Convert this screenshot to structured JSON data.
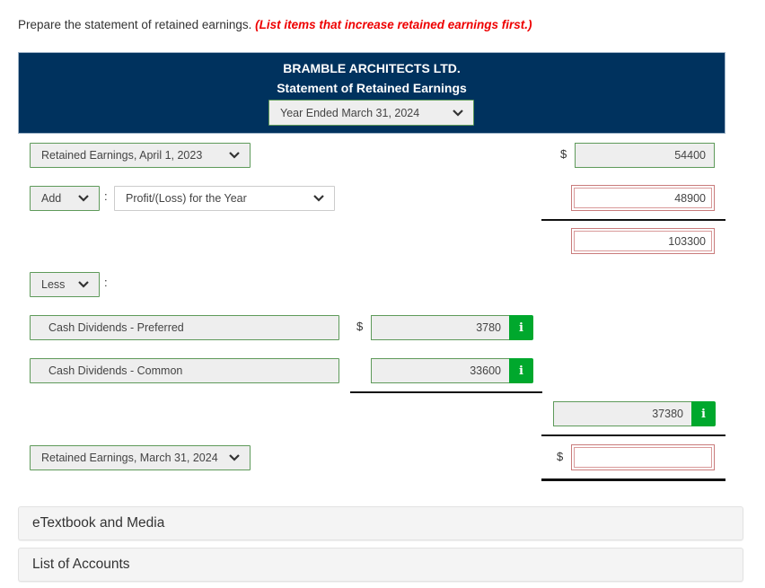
{
  "instruction": {
    "text": "Prepare the statement of retained earnings. ",
    "note": "(List items that increase retained earnings first.)"
  },
  "header": {
    "company": "BRAMBLE ARCHITECTS LTD.",
    "statement": "Statement of Retained Earnings",
    "period": "Year Ended March 31, 2024"
  },
  "rows": {
    "opening": {
      "label": "Retained Earnings, April 1, 2023",
      "currency": "$",
      "value": "54400"
    },
    "add": {
      "operator": "Add",
      "separator": ":",
      "label": "Profit/(Loss) for the Year",
      "value": "48900"
    },
    "subtotal": {
      "value": "103300"
    },
    "less": {
      "operator": "Less",
      "separator": ":"
    },
    "dividend_preferred": {
      "label": "Cash Dividends - Preferred",
      "currency": "$",
      "value": "3780",
      "info": "i"
    },
    "dividend_common": {
      "label": "Cash Dividends - Common",
      "value": "33600",
      "info": "i"
    },
    "total_less": {
      "value": "37380",
      "info": "i"
    },
    "closing": {
      "label": "Retained Earnings, March 31, 2024",
      "currency": "$",
      "value": ""
    }
  },
  "accordions": [
    {
      "label": "eTextbook and Media"
    },
    {
      "label": "List of Accounts"
    }
  ],
  "colors": {
    "header_bg": "#00325e",
    "correct_border": "#5e9a5a",
    "error_border": "#c97b7b",
    "info_button": "#00a82d",
    "note_red": "#ee0000"
  }
}
